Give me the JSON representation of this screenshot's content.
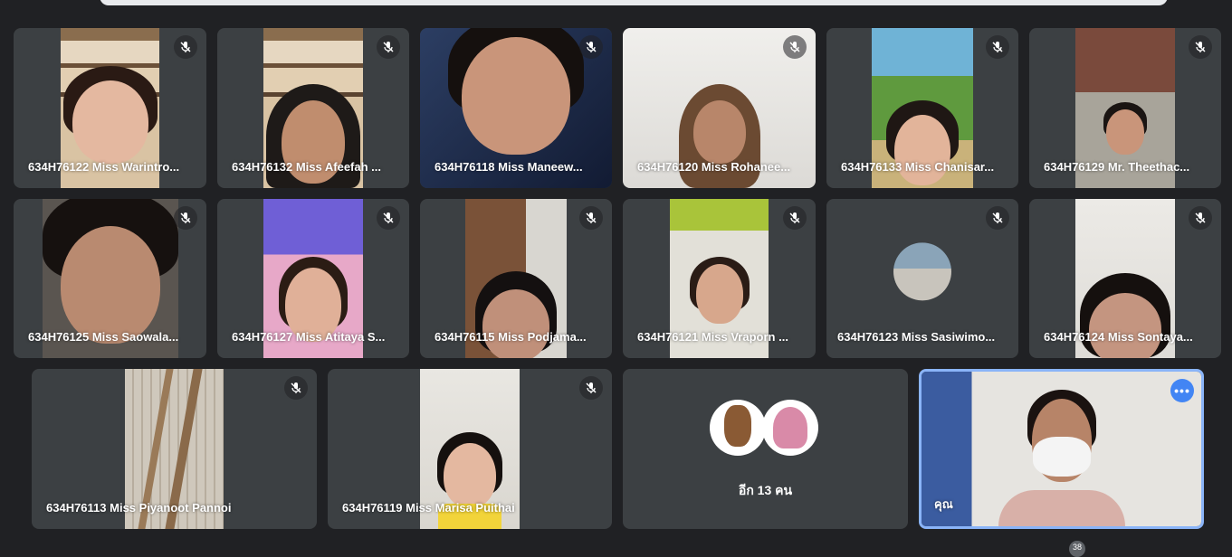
{
  "participants": [
    {
      "name": "634H76122 Miss Warintro..."
    },
    {
      "name": "634H76132 Miss Afeefah ..."
    },
    {
      "name": "634H76118 Miss Maneew..."
    },
    {
      "name": "634H76120 Miss Rohanee..."
    },
    {
      "name": "634H76133 Miss Chanisar..."
    },
    {
      "name": "634H76129 Mr. Theethac..."
    },
    {
      "name": "634H76125 Miss Saowala..."
    },
    {
      "name": "634H76127 Miss Atitaya S..."
    },
    {
      "name": "634H76115 Miss Podjama..."
    },
    {
      "name": "634H76121 Miss Vraporn ..."
    },
    {
      "name": "634H76123 Miss Sasiwimo..."
    },
    {
      "name": "634H76124 Miss Sontaya..."
    },
    {
      "name": "634H76113 Miss Piyanoot Pannoi"
    },
    {
      "name": "634H76119 Miss Marisa Puithai"
    }
  ],
  "others": {
    "label": "อีก 13 คน"
  },
  "self": {
    "label": "คุณ",
    "more_label": "•••"
  },
  "counter": {
    "value": "38"
  },
  "colors": {
    "background": "#202124",
    "tile": "#3c4043",
    "accent": "#8ab4f8",
    "more_button": "#4285f4"
  },
  "icons": {
    "mute": "mic-off-icon",
    "more": "more-options-icon"
  }
}
